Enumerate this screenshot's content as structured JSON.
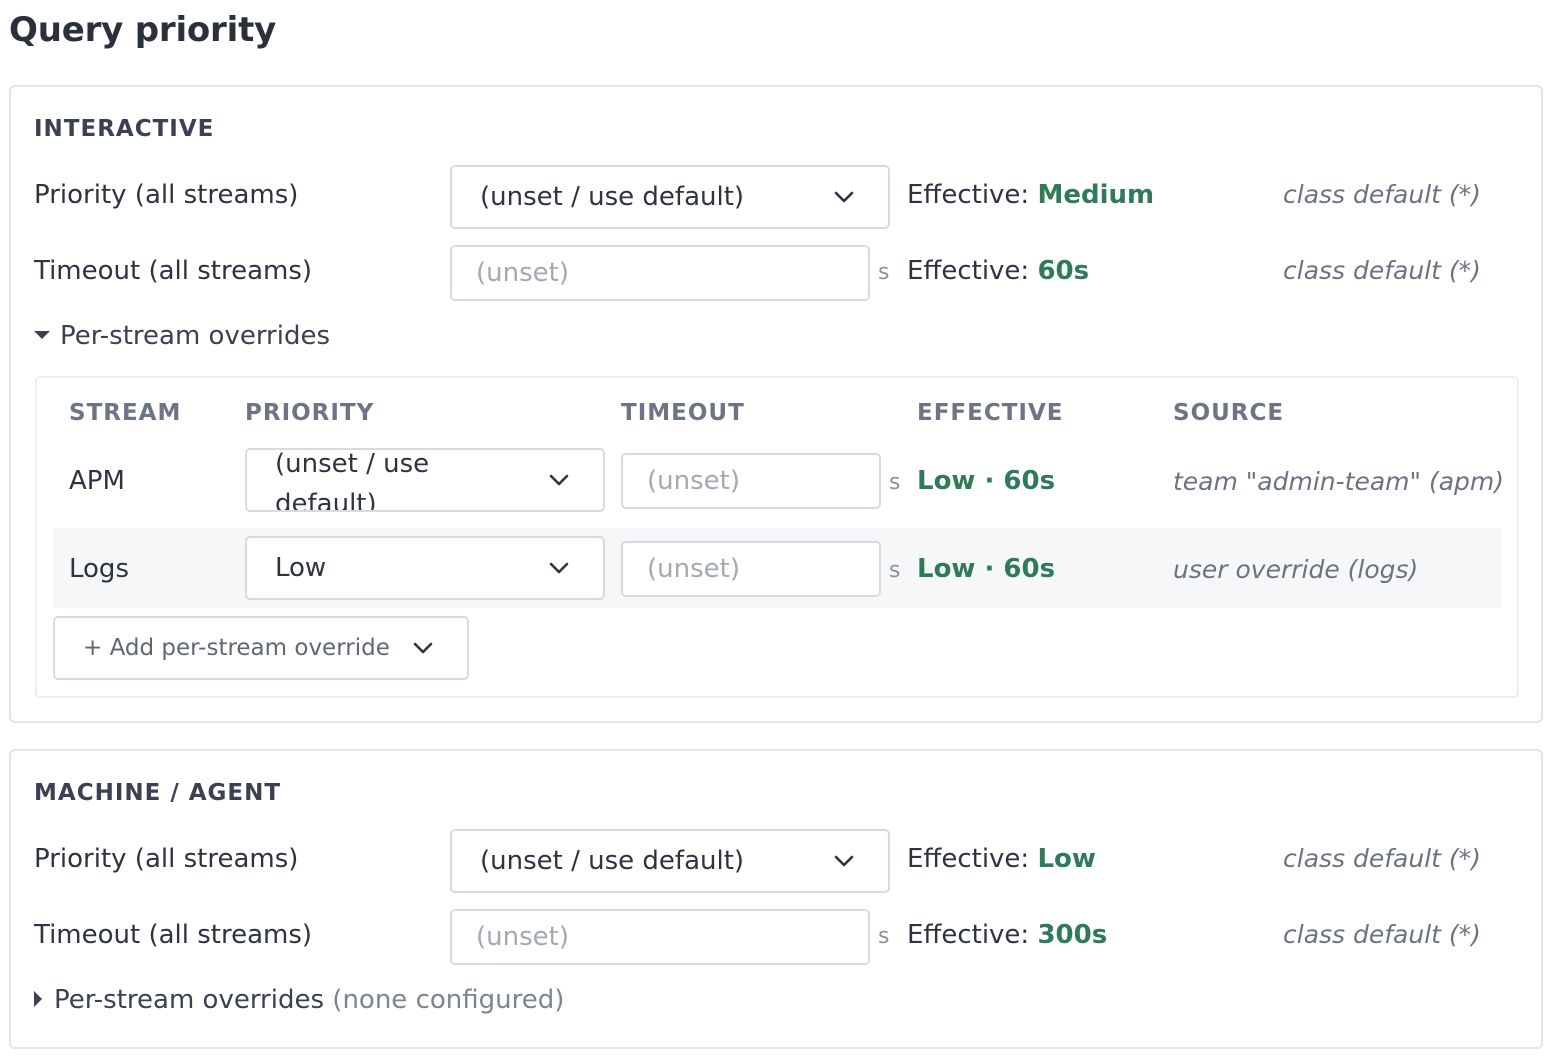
{
  "page": {
    "title": "Query priority"
  },
  "interactive": {
    "heading": "INTERACTIVE",
    "priority": {
      "label": "Priority (all streams)",
      "selected": "(unset / use default)",
      "effective_prefix": "Effective:",
      "effective_value": "Medium",
      "source": "class default (*)"
    },
    "timeout": {
      "label": "Timeout (all streams)",
      "placeholder": "(unset)",
      "unit": "s",
      "effective_prefix": "Effective:",
      "effective_value": "60s",
      "source": "class default (*)"
    },
    "overrides": {
      "toggle_label": "Per-stream overrides",
      "expanded": true,
      "headers": {
        "stream": "STREAM",
        "priority": "PRIORITY",
        "timeout": "TIMEOUT",
        "effective": "EFFECTIVE",
        "source": "SOURCE"
      },
      "rows": [
        {
          "stream": "APM",
          "priority": "(unset / use default)",
          "timeout_placeholder": "(unset)",
          "unit": "s",
          "effective": "Low · 60s",
          "source": "team \"admin-team\" (apm)"
        },
        {
          "stream": "Logs",
          "priority": "Low",
          "timeout_placeholder": "(unset)",
          "unit": "s",
          "effective": "Low · 60s",
          "source": "user override (logs)"
        }
      ],
      "add_button": "+ Add per-stream override"
    }
  },
  "machine": {
    "heading": "MACHINE / AGENT",
    "priority": {
      "label": "Priority (all streams)",
      "selected": "(unset / use default)",
      "effective_prefix": "Effective:",
      "effective_value": "Low",
      "source": "class default (*)"
    },
    "timeout": {
      "label": "Timeout (all streams)",
      "placeholder": "(unset)",
      "unit": "s",
      "effective_prefix": "Effective:",
      "effective_value": "300s",
      "source": "class default (*)"
    },
    "overrides": {
      "toggle_label": "Per-stream overrides",
      "note": "(none configured)",
      "expanded": false
    }
  },
  "colors": {
    "effective_value": "#2f7a57",
    "border": "#d7dbe1",
    "muted": "#7c8491"
  },
  "icons": {
    "select": "chevron-down-icon",
    "expanded": "caret-down-icon",
    "collapsed": "caret-right-icon"
  }
}
